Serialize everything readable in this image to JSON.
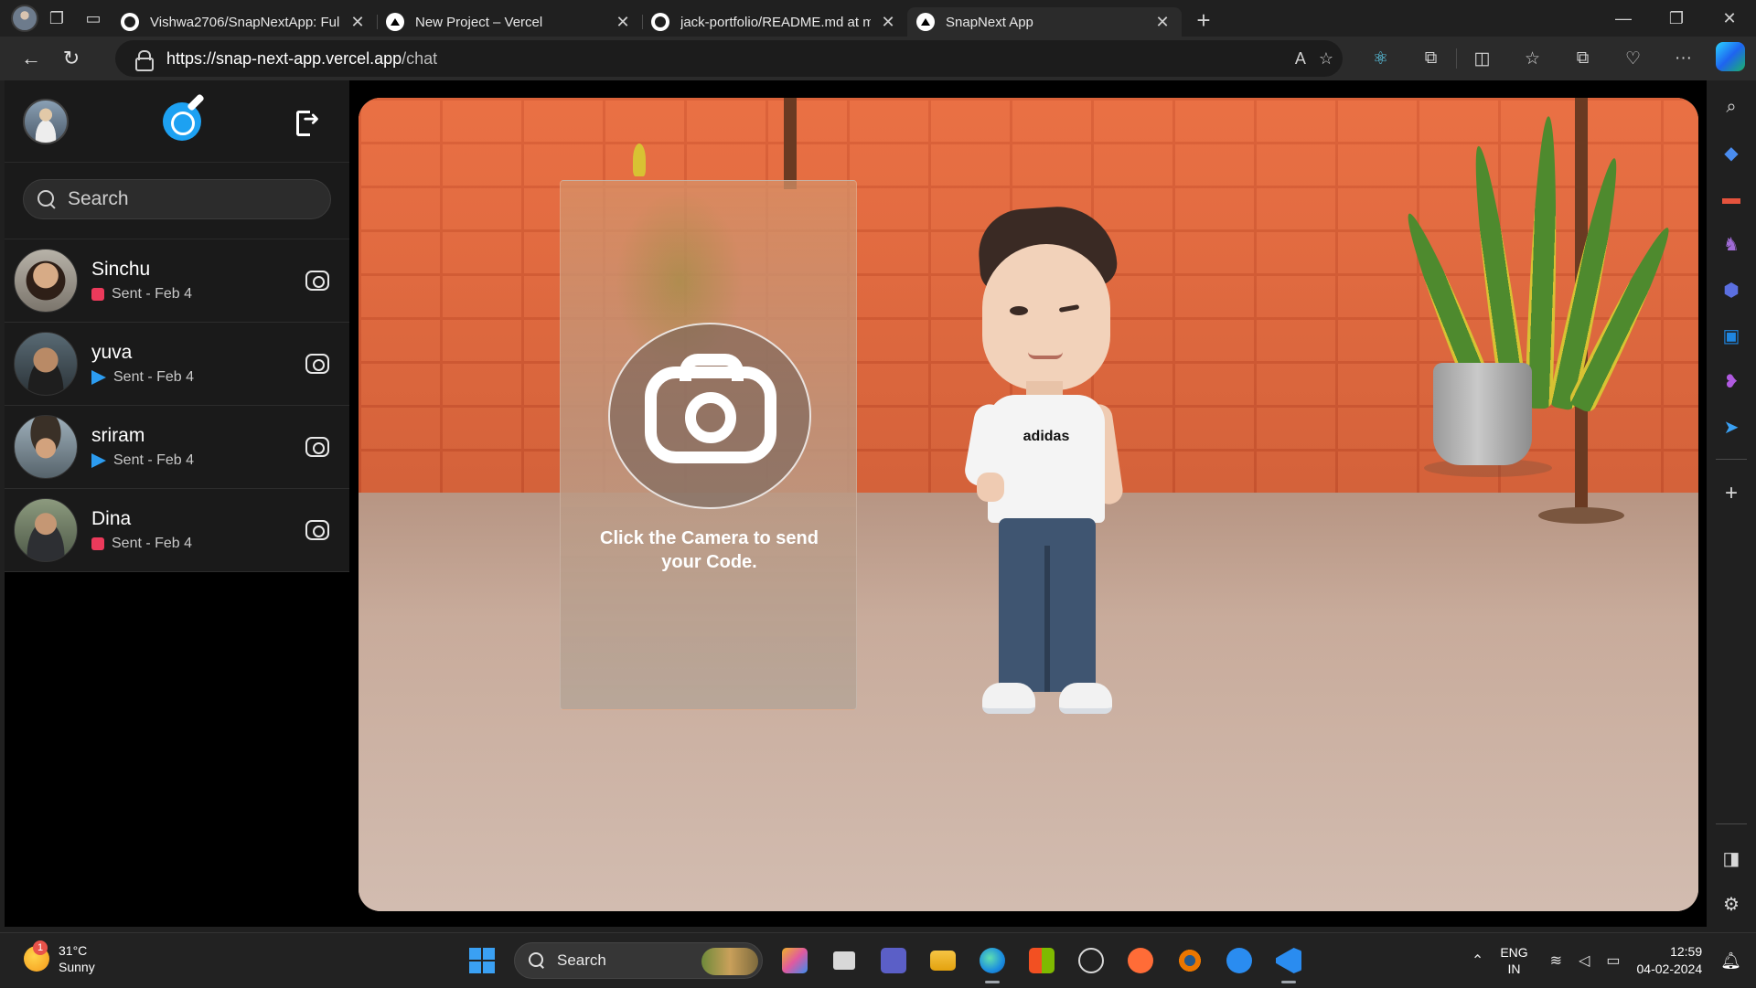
{
  "browser": {
    "tabs": [
      {
        "title": "Vishwa2706/SnapNextApp: Full S",
        "icon": "github-icon",
        "active": false
      },
      {
        "title": "New Project – Vercel",
        "icon": "vercel-icon",
        "active": false
      },
      {
        "title": "jack-portfolio/README.md at ma",
        "icon": "github-icon",
        "active": false
      },
      {
        "title": "SnapNext App",
        "icon": "vercel-icon",
        "active": true
      }
    ],
    "url_host": "https://snap-next-app.vercel.app",
    "url_path": "/chat",
    "close_glyph": "✕",
    "newtab_glyph": "+"
  },
  "sidebar": {
    "search_placeholder": "Search",
    "chats": [
      {
        "name": "Sinchu",
        "status": "Sent - Feb 4",
        "marker": "red"
      },
      {
        "name": "yuva",
        "status": "Sent - Feb 4",
        "marker": "blue"
      },
      {
        "name": "sriram",
        "status": "Sent - Feb 4",
        "marker": "blue"
      },
      {
        "name": "Dina",
        "status": "Sent - Feb 4",
        "marker": "red"
      }
    ]
  },
  "main": {
    "camera_prompt": "Click the Camera to send your Code.",
    "shirt_brand": "adidas"
  },
  "taskbar": {
    "weather_temp": "31°C",
    "weather_desc": "Sunny",
    "weather_badge": "1",
    "search_label": "Search",
    "lang_1": "ENG",
    "lang_2": "IN",
    "time": "12:59",
    "date": "04-02-2024"
  },
  "colors": {
    "accent": "#1da1f2",
    "sent_red": "#ec3a5b",
    "sent_blue": "#2c9cf0"
  }
}
